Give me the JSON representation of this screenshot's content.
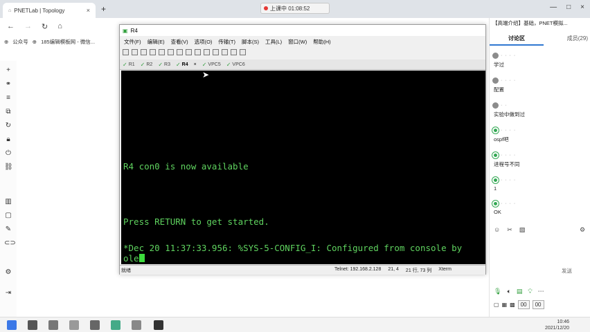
{
  "browser": {
    "tab_title": "PNETLab | Topology",
    "tab_close": "×",
    "new_tab": "+",
    "window_controls": [
      "—",
      "□",
      "×"
    ]
  },
  "recording": {
    "label": "上课中 01:08:52"
  },
  "bookmarks": [
    "公众号",
    "185编辑模板网 - 微信..."
  ],
  "terminal_window": {
    "title": "R4",
    "menu": [
      "文件(F)",
      "编辑(E)",
      "查看(V)",
      "选项(O)",
      "传输(T)",
      "脚本(S)",
      "工具(L)",
      "窗口(W)",
      "帮助(H)"
    ],
    "tabs": [
      {
        "label": "R1",
        "checked": true
      },
      {
        "label": "R2",
        "checked": true
      },
      {
        "label": "R3",
        "checked": true
      },
      {
        "label": "R4",
        "checked": true,
        "active": true
      },
      {
        "label": "VPC5",
        "checked": true
      },
      {
        "label": "VPC6",
        "checked": true
      }
    ],
    "tab_close": "×",
    "lines": [
      "R4 con0 is now available",
      "Press RETURN to get started.",
      "*Dec 20 11:37:33.956: %SYS-5-CONFIG_I: Configured from console by",
      "ole"
    ],
    "status": {
      "left": "就绪",
      "connection": "Telnet: 192.168.2.128",
      "pos": "21,   4",
      "size": "21 行, 73 列",
      "term": "Xterm"
    }
  },
  "panel": {
    "title": "【高端介绍】基础，PNET模拟...",
    "tab_discuss": "讨论区",
    "tab_members": "成员(29)",
    "messages": [
      {
        "avatar": "gray",
        "text": "学过"
      },
      {
        "avatar": "gray",
        "text": "配置"
      },
      {
        "avatar": "gray",
        "text": "实验中做到过"
      },
      {
        "avatar": "green",
        "text": "ospf吧"
      },
      {
        "avatar": "green",
        "text": "进程号不同"
      },
      {
        "avatar": "green",
        "text": "1"
      },
      {
        "avatar": "green",
        "text": "OK"
      }
    ],
    "send_label": "发送",
    "counter_a": "00",
    "counter_b": "00"
  },
  "taskbar": {
    "time": "10:46",
    "date": "2021/12/20"
  },
  "colors": {
    "terminal_bg": "#000000",
    "terminal_fg": "#5fd35f",
    "accent": "#2f77d1"
  }
}
